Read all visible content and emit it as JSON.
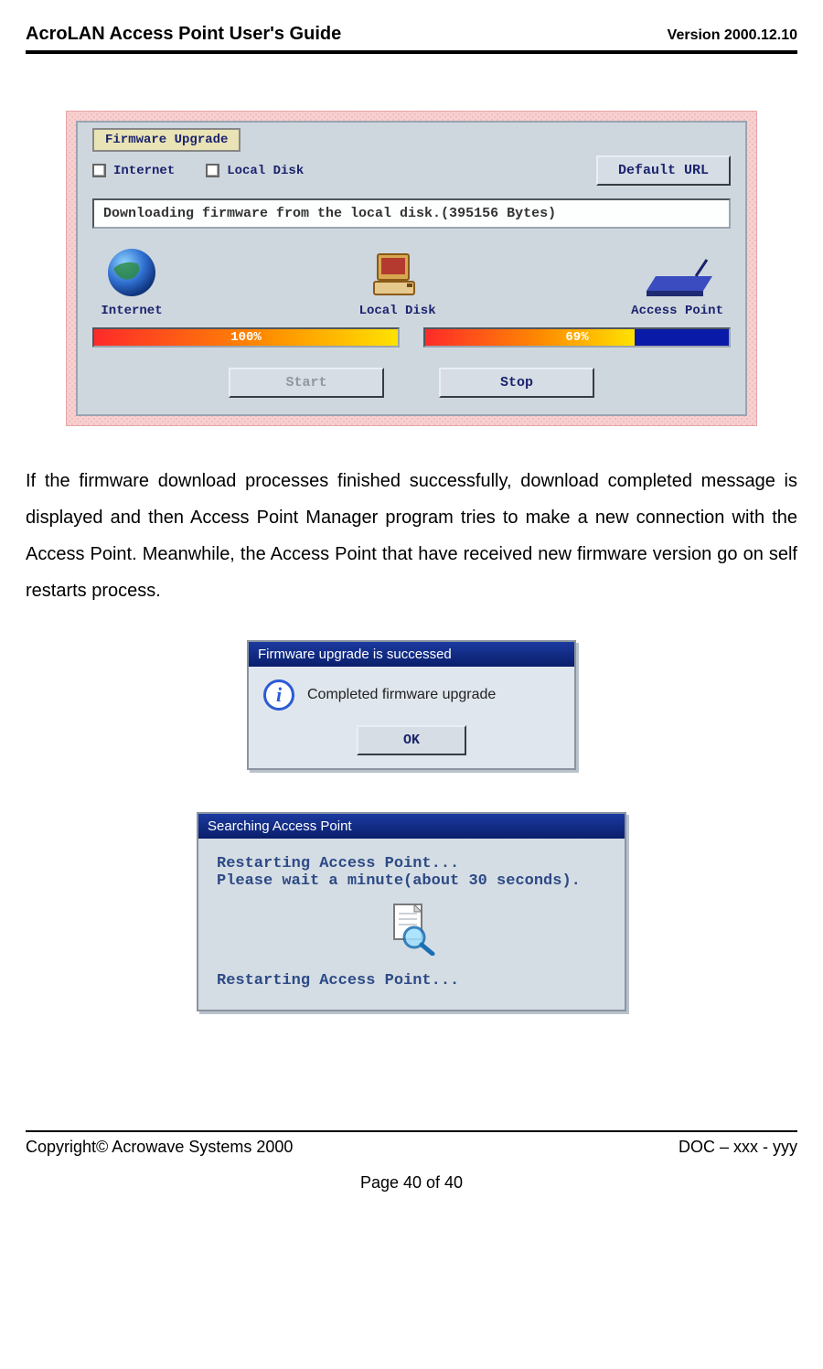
{
  "header": {
    "title": "AcroLAN Access Point User's Guide",
    "version": "Version 2000.12.10"
  },
  "firmware_panel": {
    "group_label": "Firmware Upgrade",
    "checkbox_internet": "Internet",
    "checkbox_localdisk": "Local Disk",
    "default_url_btn": "Default URL",
    "status_text": "Downloading firmware from the local disk.(395156 Bytes)",
    "icon_internet_label": "Internet",
    "icon_localdisk_label": "Local Disk",
    "icon_ap_label": "Access Point",
    "progress1_pct": "100%",
    "progress2_pct": "69%",
    "start_btn": "Start",
    "stop_btn": "Stop"
  },
  "paragraph": "If the firmware download processes finished successfully, download completed message is displayed and then Access Point Manager program tries to make a new connection with the Access Point. Meanwhile, the Access Point that have received new firmware version go on self restarts process.",
  "success_dialog": {
    "title": "Firmware upgrade is successed",
    "message": "Completed firmware upgrade",
    "ok": "OK"
  },
  "search_dialog": {
    "title": "Searching Access Point",
    "line1": "Restarting Access Point...",
    "line2": "Please wait a minute(about 30 seconds).",
    "line3": "Restarting Access Point..."
  },
  "footer": {
    "copyright": "Copyright© Acrowave Systems 2000",
    "doc": "DOC – xxx - yyy",
    "page": "Page 40 of 40"
  }
}
